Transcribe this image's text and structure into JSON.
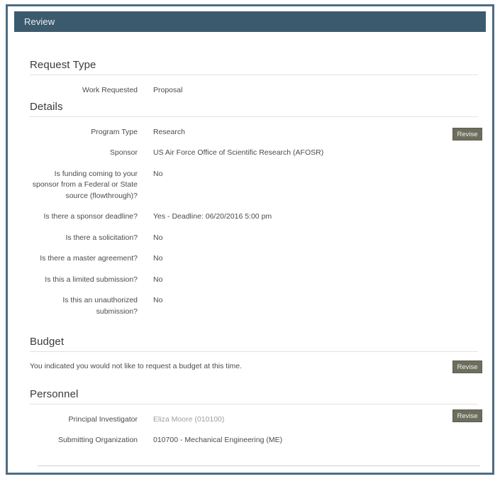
{
  "panel": {
    "header_title": "Review"
  },
  "sections": {
    "request_type": {
      "title": "Request Type",
      "fields": [
        {
          "label": "Work Requested",
          "value": "Proposal"
        }
      ]
    },
    "details": {
      "title": "Details",
      "revise_label": "Revise",
      "fields": [
        {
          "label": "Program Type",
          "value": "Research"
        },
        {
          "label": "Sponsor",
          "value": "US Air Force Office of Scientific Research (AFOSR)"
        },
        {
          "label": "Is funding coming to your sponsor from a Federal or State source (flowthrough)?",
          "value": "No"
        },
        {
          "label": "Is there a sponsor deadline?",
          "value": "Yes - Deadline: 06/20/2016 5:00 pm"
        },
        {
          "label": "Is there a solicitation?",
          "value": "No"
        },
        {
          "label": "Is there a master agreement?",
          "value": "No"
        },
        {
          "label": "Is this a limited submission?",
          "value": "No"
        },
        {
          "label": "Is this an unauthorized submission?",
          "value": "No"
        }
      ]
    },
    "budget": {
      "title": "Budget",
      "revise_label": "Revise",
      "note": "You indicated you would not like to request a budget at this time."
    },
    "personnel": {
      "title": "Personnel",
      "revise_label": "Revise",
      "fields": [
        {
          "label": "Principal Investigator",
          "value": "Eliza Moore (010100)"
        },
        {
          "label": "Submitting Organization",
          "value": "010700 - Mechanical Engineering (ME)"
        }
      ]
    }
  },
  "colors": {
    "frame_border": "#4d6d82",
    "header_bar": "#3c5a6e",
    "revise_button": "#6e6e5e",
    "text": "#4b4b4b",
    "muted_text": "#9aa0a3",
    "rule": "#e2e2e2"
  }
}
